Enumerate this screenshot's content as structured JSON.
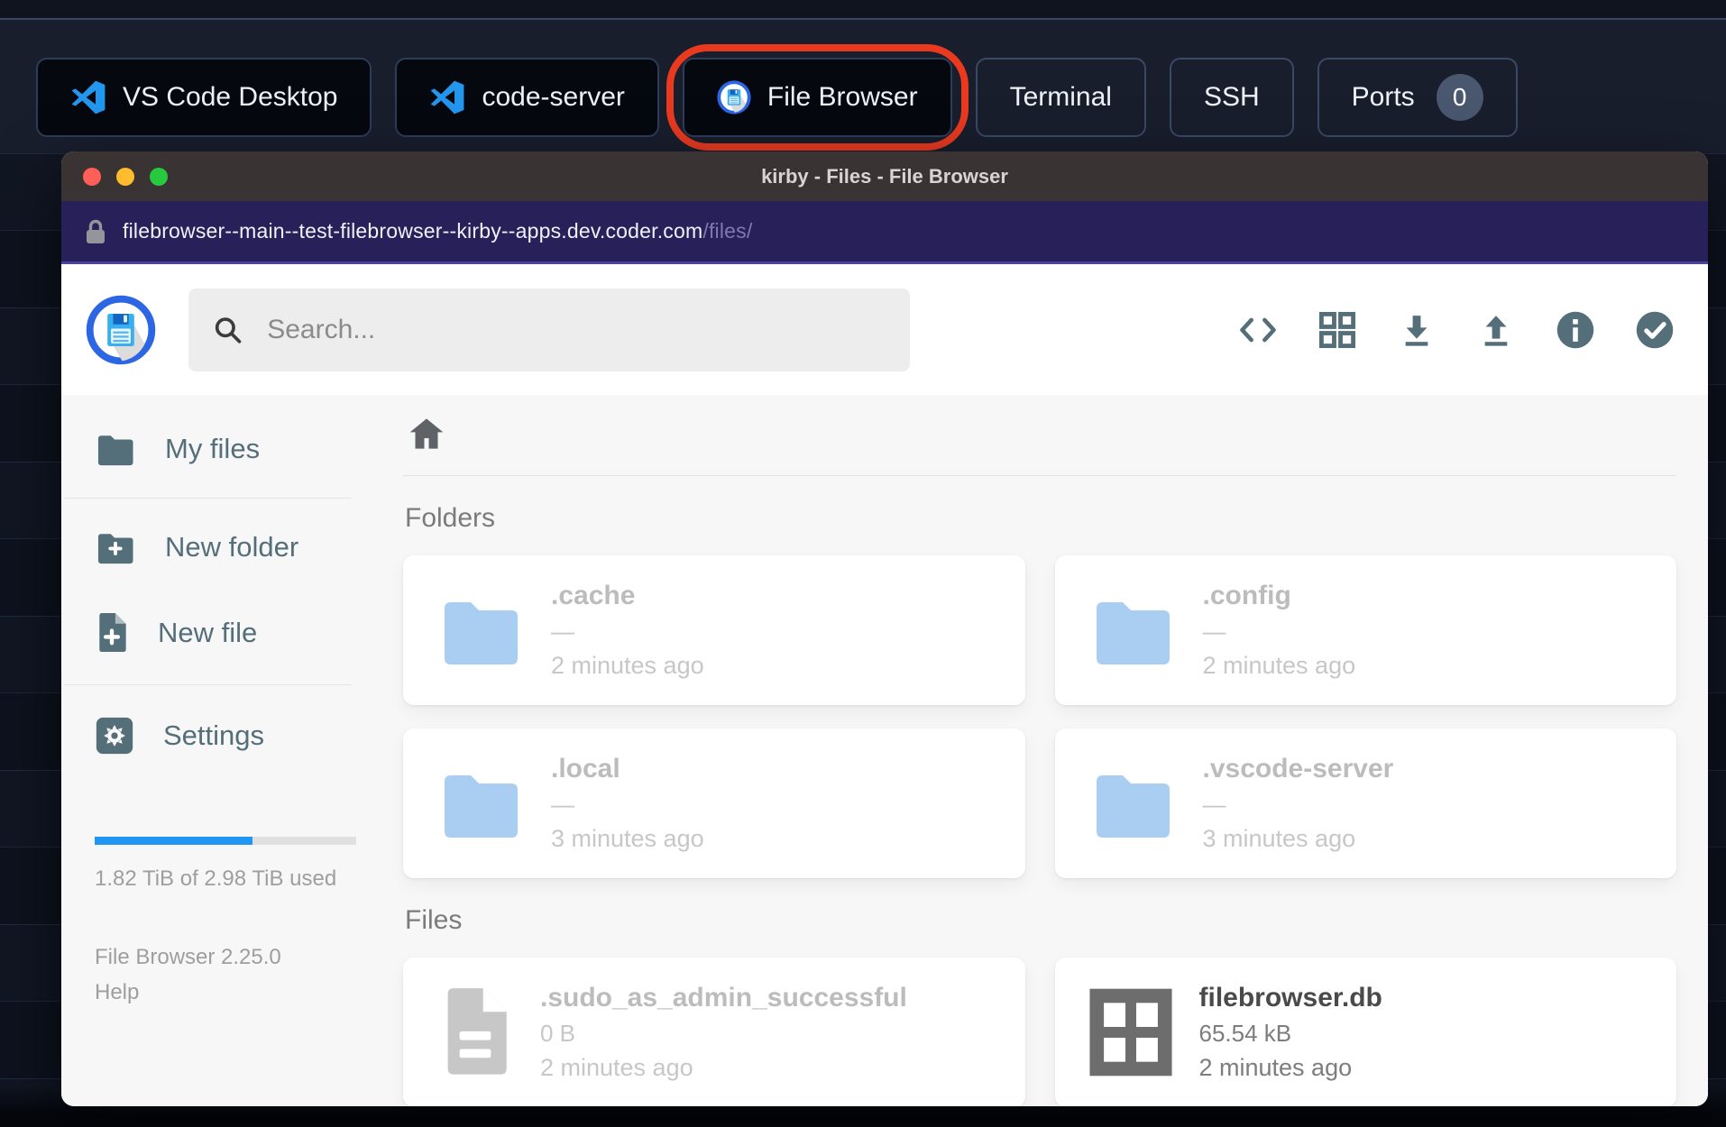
{
  "taskbar": {
    "tabs": [
      {
        "label": "VS Code Desktop",
        "icon": "vscode-icon"
      },
      {
        "label": "code-server",
        "icon": "vscode-icon"
      },
      {
        "label": "File Browser",
        "icon": "filebrowser-logo-icon",
        "annotated": true
      },
      {
        "label": "Terminal"
      },
      {
        "label": "SSH"
      },
      {
        "label": "Ports"
      }
    ],
    "ports_count": "0"
  },
  "window": {
    "title": "kirby - Files - File Browser",
    "url_host": "filebrowser--main--test-filebrowser--kirby--apps.dev.coder.com",
    "url_path": "/files/"
  },
  "header": {
    "search_placeholder": "Search..."
  },
  "toolbar_icons": [
    "code-icon",
    "grid-view-icon",
    "download-icon",
    "upload-icon",
    "info-icon",
    "check-circle-icon"
  ],
  "sidebar": {
    "items": [
      {
        "label": "My files",
        "icon": "folder-icon"
      },
      {
        "label": "New folder",
        "icon": "folder-plus-icon"
      },
      {
        "label": "New file",
        "icon": "file-plus-icon"
      },
      {
        "label": "Settings",
        "icon": "gear-icon"
      }
    ],
    "usage_text": "1.82 TiB of 2.98 TiB used",
    "usage_percent": 60.5,
    "version": "File Browser 2.25.0",
    "help": "Help"
  },
  "listing": {
    "folders_header": "Folders",
    "files_header": "Files",
    "folders": [
      {
        "name": ".cache",
        "size": "—",
        "modified": "2 minutes ago"
      },
      {
        "name": ".config",
        "size": "—",
        "modified": "2 minutes ago"
      },
      {
        "name": ".local",
        "size": "—",
        "modified": "3 minutes ago"
      },
      {
        "name": ".vscode-server",
        "size": "—",
        "modified": "3 minutes ago"
      }
    ],
    "files": [
      {
        "name": ".sudo_as_admin_successful",
        "size": "0 B",
        "modified": "2 minutes ago",
        "dimmed": true
      },
      {
        "name": "filebrowser.db",
        "size": "65.54 kB",
        "modified": "2 minutes ago",
        "dimmed": false
      }
    ]
  },
  "colors": {
    "accent_blue": "#2196f3",
    "folder_blue_dim": "#aacdf2",
    "toolbar_gray": "#546e7a",
    "annotation_red": "#e93a20",
    "titlebar": "#3a3333",
    "urlbar": "#272059",
    "traffic_red": "#ff5f57",
    "traffic_yellow": "#febc2e",
    "traffic_green": "#27c93f"
  }
}
